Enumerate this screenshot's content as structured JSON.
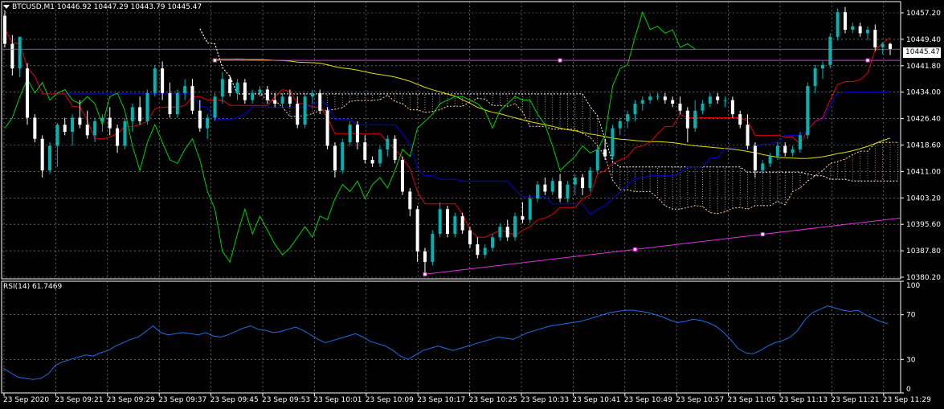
{
  "symbol_header": {
    "text": "BTCUSD,M1  10446.92 10447.29 10443.79 10445.47"
  },
  "rsi_header": {
    "text": "RSI(14) 61.7469"
  },
  "current_price": "10445.47",
  "colors": {
    "background": "#000000",
    "grid": "#9a9a9a",
    "bull_candle": "#00b4b4",
    "bear_candle": "#ffffff",
    "tenkan": "#e00000",
    "kijun": "#0000e0",
    "chikou": "#00d000",
    "senkou_a": "#ffd29a",
    "senkou_b": "#ffffff",
    "ma_line": "#e0e000",
    "trendline": "#e030e0",
    "rsi_line": "#1e6ee6"
  },
  "price_axis": {
    "labels": [
      "10457.20",
      "10449.40",
      "10441.80",
      "10434.00",
      "10426.40",
      "10418.60",
      "10411.00",
      "10403.20",
      "10395.60",
      "10387.80",
      "10380.20"
    ]
  },
  "rsi_axis": {
    "labels": [
      "100",
      "70",
      "30",
      "0"
    ]
  },
  "time_axis": {
    "labels": [
      "23 Sep 2020",
      "23 Sep 09:21",
      "23 Sep 09:29",
      "23 Sep 09:37",
      "23 Sep 09:45",
      "23 Sep 09:53",
      "23 Sep 10:01",
      "23 Sep 10:09",
      "23 Sep 10:17",
      "23 Sep 10:25",
      "23 Sep 10:33",
      "23 Sep 10:41",
      "23 Sep 10:49",
      "23 Sep 10:57",
      "23 Sep 11:05",
      "23 Sep 11:13",
      "23 Sep 11:21",
      "23 Sep 11:29"
    ]
  },
  "chart_data": [
    {
      "type": "candlestick",
      "ylim": [
        10380.2,
        10459.0
      ],
      "candles": [
        [
          10455.0,
          10456.5,
          10446.0,
          10447.0
        ],
        [
          10447.0,
          10449.5,
          10438.0,
          10440.0
        ],
        [
          10440.0,
          10449.0,
          10437.5,
          10449.0
        ],
        [
          10440.0,
          10441.5,
          10424.0,
          10426.0
        ],
        [
          10426.0,
          10427.0,
          10419.0,
          10420.0
        ],
        [
          10420.0,
          10421.0,
          10409.0,
          10411.0
        ],
        [
          10411.0,
          10419.0,
          10410.0,
          10418.0
        ],
        [
          10418.0,
          10424.5,
          10412.0,
          10424.0
        ],
        [
          10424.0,
          10426.0,
          10421.0,
          10422.0
        ],
        [
          10422.0,
          10427.0,
          10418.0,
          10426.0
        ],
        [
          10426.0,
          10431.0,
          10423.0,
          10424.0
        ],
        [
          10424.0,
          10428.0,
          10420.0,
          10421.0
        ],
        [
          10421.0,
          10426.0,
          10419.0,
          10425.0
        ],
        [
          10425.0,
          10427.0,
          10422.0,
          10426.0
        ],
        [
          10426.0,
          10429.0,
          10421.0,
          10423.0
        ],
        [
          10423.0,
          10424.0,
          10416.0,
          10418.0
        ],
        [
          10418.0,
          10426.0,
          10417.0,
          10425.0
        ],
        [
          10425.0,
          10430.0,
          10422.0,
          10429.0
        ],
        [
          10429.0,
          10432.0,
          10424.0,
          10425.0
        ],
        [
          10425.0,
          10434.0,
          10424.0,
          10433.0
        ],
        [
          10433.0,
          10441.0,
          10432.0,
          10440.0
        ],
        [
          10440.0,
          10442.0,
          10431.0,
          10433.0
        ],
        [
          10433.0,
          10436.0,
          10426.0,
          10427.0
        ],
        [
          10427.0,
          10434.0,
          10426.0,
          10433.0
        ],
        [
          10433.0,
          10437.0,
          10431.0,
          10435.0
        ],
        [
          10435.0,
          10437.0,
          10427.0,
          10428.0
        ],
        [
          10428.0,
          10431.0,
          10422.0,
          10423.0
        ],
        [
          10423.0,
          10427.0,
          10420.0,
          10426.0
        ],
        [
          10426.0,
          10433.0,
          10425.0,
          10432.0
        ],
        [
          10432.0,
          10439.0,
          10430.0,
          10437.0
        ],
        [
          10437.0,
          10438.0,
          10432.0,
          10433.0
        ],
        [
          10433.0,
          10437.0,
          10431.0,
          10436.0
        ],
        [
          10436.0,
          10437.0,
          10430.0,
          10431.0
        ],
        [
          10431.0,
          10434.0,
          10430.0,
          10433.0
        ],
        [
          10433.0,
          10435.0,
          10432.0,
          10434.0
        ],
        [
          10434.0,
          10435.0,
          10430.0,
          10431.0
        ],
        [
          10431.0,
          10433.0,
          10429.0,
          10430.0
        ],
        [
          10430.0,
          10433.0,
          10429.0,
          10432.0
        ],
        [
          10432.0,
          10434.0,
          10429.0,
          10430.0
        ],
        [
          10430.0,
          10432.0,
          10423.0,
          10424.0
        ],
        [
          10424.0,
          10433.0,
          10423.0,
          10432.0
        ],
        [
          10432.0,
          10434.0,
          10430.0,
          10433.0
        ],
        [
          10433.0,
          10434.0,
          10427.0,
          10428.0
        ],
        [
          10428.0,
          10429.0,
          10417.0,
          10418.0
        ],
        [
          10418.0,
          10419.0,
          10409.0,
          10411.0
        ],
        [
          10411.0,
          10420.0,
          10410.0,
          10419.0
        ],
        [
          10419.0,
          10425.0,
          10418.0,
          10424.0
        ],
        [
          10424.0,
          10425.0,
          10417.0,
          10419.0
        ],
        [
          10419.0,
          10421.0,
          10413.0,
          10414.0
        ],
        [
          10414.0,
          10415.0,
          10412.0,
          10413.0
        ],
        [
          10413.0,
          10418.0,
          10412.0,
          10417.0
        ],
        [
          10417.0,
          10421.0,
          10415.0,
          10420.0
        ],
        [
          10420.0,
          10421.0,
          10413.0,
          10414.0
        ],
        [
          10414.0,
          10415.0,
          10404.0,
          10405.0
        ],
        [
          10405.0,
          10406.0,
          10398.0,
          10400.0
        ],
        [
          10400.0,
          10401.0,
          10385.0,
          10388.0
        ],
        [
          10388.0,
          10389.0,
          10382.0,
          10385.0
        ],
        [
          10385.0,
          10394.0,
          10384.0,
          10393.0
        ],
        [
          10393.0,
          10402.0,
          10392.0,
          10400.0
        ],
        [
          10400.0,
          10401.0,
          10392.0,
          10393.0
        ],
        [
          10393.0,
          10399.0,
          10392.0,
          10398.0
        ],
        [
          10398.0,
          10399.0,
          10393.0,
          10394.0
        ],
        [
          10394.0,
          10395.0,
          10389.0,
          10390.0
        ],
        [
          10390.0,
          10392.0,
          10386.0,
          10387.0
        ],
        [
          10387.0,
          10390.0,
          10386.0,
          10389.0
        ],
        [
          10389.0,
          10393.0,
          10388.0,
          10392.0
        ],
        [
          10392.0,
          10396.0,
          10391.0,
          10395.0
        ],
        [
          10395.0,
          10397.0,
          10391.0,
          10392.0
        ],
        [
          10392.0,
          10399.0,
          10391.0,
          10398.0
        ],
        [
          10398.0,
          10402.0,
          10396.0,
          10397.0
        ],
        [
          10397.0,
          10404.0,
          10396.0,
          10403.0
        ],
        [
          10403.0,
          10408.0,
          10402.0,
          10407.0
        ],
        [
          10407.0,
          10409.0,
          10404.0,
          10405.0
        ],
        [
          10405.0,
          10409.0,
          10404.0,
          10408.0
        ],
        [
          10408.0,
          10410.0,
          10402.0,
          10403.0
        ],
        [
          10403.0,
          10408.0,
          10402.0,
          10407.0
        ],
        [
          10407.0,
          10410.0,
          10404.0,
          10409.0
        ],
        [
          10409.0,
          10410.0,
          10404.0,
          10406.0
        ],
        [
          10406.0,
          10412.0,
          10405.0,
          10411.0
        ],
        [
          10411.0,
          10418.0,
          10410.0,
          10417.0
        ],
        [
          10417.0,
          10420.0,
          10414.0,
          10415.0
        ],
        [
          10415.0,
          10424.0,
          10414.0,
          10423.0
        ],
        [
          10423.0,
          10426.0,
          10421.0,
          10425.0
        ],
        [
          10425.0,
          10428.0,
          10423.0,
          10427.0
        ],
        [
          10427.0,
          10431.0,
          10425.0,
          10430.0
        ],
        [
          10430.0,
          10432.0,
          10428.0,
          10431.0
        ],
        [
          10431.0,
          10433.0,
          10430.0,
          10432.0
        ],
        [
          10432.0,
          10433.0,
          10431.0,
          10432.0
        ],
        [
          10432.0,
          10433.0,
          10430.0,
          10431.0
        ],
        [
          10431.0,
          10432.0,
          10429.0,
          10430.0
        ],
        [
          10430.0,
          10432.0,
          10427.0,
          10428.0
        ],
        [
          10428.0,
          10429.0,
          10419.0,
          10423.0
        ],
        [
          10423.0,
          10431.0,
          10422.0,
          10428.0
        ],
        [
          10428.0,
          10431.0,
          10427.0,
          10430.0
        ],
        [
          10430.0,
          10433.0,
          10429.0,
          10432.0
        ],
        [
          10432.0,
          10433.0,
          10430.0,
          10431.0
        ],
        [
          10431.0,
          10432.0,
          10429.0,
          10431.0
        ],
        [
          10431.0,
          10432.0,
          10426.0,
          10427.0
        ],
        [
          10427.0,
          10428.0,
          10423.0,
          10424.0
        ],
        [
          10424.0,
          10427.0,
          10417.0,
          10418.0
        ],
        [
          10418.0,
          10419.0,
          10409.0,
          10411.0
        ],
        [
          10411.0,
          10414.0,
          10410.0,
          10413.0
        ],
        [
          10413.0,
          10416.0,
          10412.0,
          10415.0
        ],
        [
          10415.0,
          10419.0,
          10414.0,
          10418.0
        ],
        [
          10418.0,
          10419.0,
          10415.0,
          10416.0
        ],
        [
          10416.0,
          10418.0,
          10415.0,
          10417.0
        ],
        [
          10417.0,
          10422.0,
          10416.0,
          10421.0
        ],
        [
          10421.0,
          10436.0,
          10420.0,
          10435.0
        ],
        [
          10435.0,
          10441.0,
          10433.0,
          10440.0
        ],
        [
          10440.0,
          10442.0,
          10437.0,
          10441.0
        ],
        [
          10441.0,
          10450.0,
          10440.0,
          10449.0
        ],
        [
          10449.0,
          10457.0,
          10448.0,
          10456.0
        ],
        [
          10456.0,
          10457.5,
          10450.0,
          10451.0
        ],
        [
          10451.0,
          10453.0,
          10450.0,
          10452.0
        ],
        [
          10452.0,
          10453.0,
          10449.0,
          10450.0
        ],
        [
          10450.0,
          10452.0,
          10448.0,
          10451.0
        ],
        [
          10451.0,
          10452.5,
          10445.0,
          10446.0
        ],
        [
          10446.0,
          10447.5,
          10444.0,
          10447.0
        ],
        [
          10447.0,
          10447.3,
          10443.8,
          10445.5
        ]
      ],
      "horizontal_level": 10442.3,
      "bid_line": 10445.47,
      "trendline_points": [
        [
          56,
          10381.5
        ],
        [
          84,
          10386.0
        ],
        [
          101,
          10388.5
        ],
        [
          121,
          10392.0
        ],
        [
          146,
          10397.5
        ]
      ],
      "resistance_points": [
        [
          28,
          10442.5
        ],
        [
          74,
          10442.3
        ],
        [
          115,
          10442.0
        ]
      ]
    },
    {
      "type": "line",
      "title": "RSI(14) 61.7469",
      "ylim": [
        0,
        100
      ],
      "levels": [
        30,
        70
      ],
      "values": [
        22,
        18,
        14,
        13,
        12,
        13,
        17,
        25,
        28,
        30,
        32,
        34,
        33,
        36,
        38,
        42,
        45,
        48,
        50,
        55,
        60,
        54,
        52,
        53,
        54,
        53,
        52,
        54,
        51,
        50,
        52,
        55,
        58,
        60,
        57,
        56,
        54,
        55,
        57,
        59,
        56,
        52,
        48,
        45,
        47,
        49,
        51,
        53,
        50,
        46,
        44,
        42,
        38,
        33,
        30,
        34,
        38,
        40,
        42,
        40,
        38,
        40,
        42,
        44,
        46,
        48,
        50,
        49,
        48,
        51,
        54,
        56,
        58,
        60,
        61,
        62,
        63,
        64,
        66,
        68,
        70,
        72,
        73,
        74,
        74,
        73,
        72,
        70,
        68,
        65,
        63,
        64,
        66,
        65,
        63,
        60,
        55,
        48,
        40,
        36,
        35,
        38,
        42,
        45,
        47,
        50,
        56,
        66,
        72,
        75,
        78,
        76,
        74,
        73,
        74,
        70,
        67,
        64,
        62
      ]
    }
  ]
}
